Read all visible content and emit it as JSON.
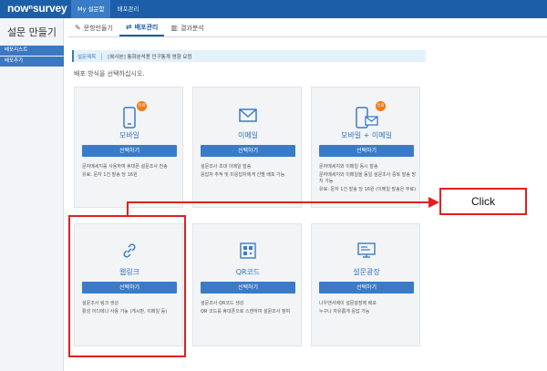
{
  "header": {
    "logo": "nowⁿsurvey",
    "nav": [
      "My 설문함",
      "배포관리"
    ]
  },
  "sidebar": {
    "title": "설문 만들기",
    "items": [
      "배포리스트",
      "배포추가"
    ]
  },
  "tabs": [
    {
      "label": "문항만들기",
      "icon": "pencil-icon"
    },
    {
      "label": "배포관리",
      "icon": "share-icon"
    },
    {
      "label": "결과분석",
      "icon": "chart-icon"
    }
  ],
  "survey_bar": {
    "label": "설문제목",
    "name": "[복사본] 통화분석용 인구통계 영향 요컴"
  },
  "instruction": "배포 방식을 선택하십시오.",
  "cards": [
    {
      "title": "모바일",
      "icon": "mobile-icon",
      "badge": "유료",
      "button": "선택하기",
      "desc": [
        "문자메세지를 사용하여 휴대폰 설문조사 전송",
        "유료: 문자 1건 발송 당 16원"
      ]
    },
    {
      "title": "이메일",
      "icon": "email-icon",
      "badge": "",
      "button": "선택하기",
      "desc": [
        "설문조사 초대 이메일 발송",
        "응답자 추적 및 미응답자에게 선별 배포 가능"
      ]
    },
    {
      "title": "모바일 + 이메일",
      "icon": "mobile-email-icon",
      "badge": "유료",
      "button": "선택하기",
      "desc": [
        "문자메세지와 이메일 동시 발송",
        "문자메세지와 이메일을 동일 설문조사 중복 발송 방지 가능",
        "유료: 문자 1건 발송 당 16원 (이메일 발송은 무료)"
      ]
    },
    {
      "title": "웹링크",
      "icon": "link-icon",
      "badge": "",
      "button": "선택하기",
      "desc": [
        "설문조사 링크 생성",
        "활성 어디에나 사용 가능 (게시판, 이메일 등)"
      ]
    },
    {
      "title": "QR코드",
      "icon": "qr-code-icon",
      "badge": "",
      "button": "선택하기",
      "desc": [
        "설문조사 QR코드 생성",
        "QR 코드를 휴대폰으로 스캔하여 설문조사 참여"
      ]
    },
    {
      "title": "설문광장",
      "icon": "survey-square-icon",
      "badge": "",
      "button": "선택하기",
      "desc": [
        "나우앤서베이 설문광장에 배포",
        "누구나 자유롭게 응답 가능"
      ]
    }
  ],
  "callout": "Click",
  "colors": {
    "brand": "#1d5ea8",
    "button": "#3a7bc8",
    "highlight": "#e02020",
    "badge": "#f07a1a"
  }
}
